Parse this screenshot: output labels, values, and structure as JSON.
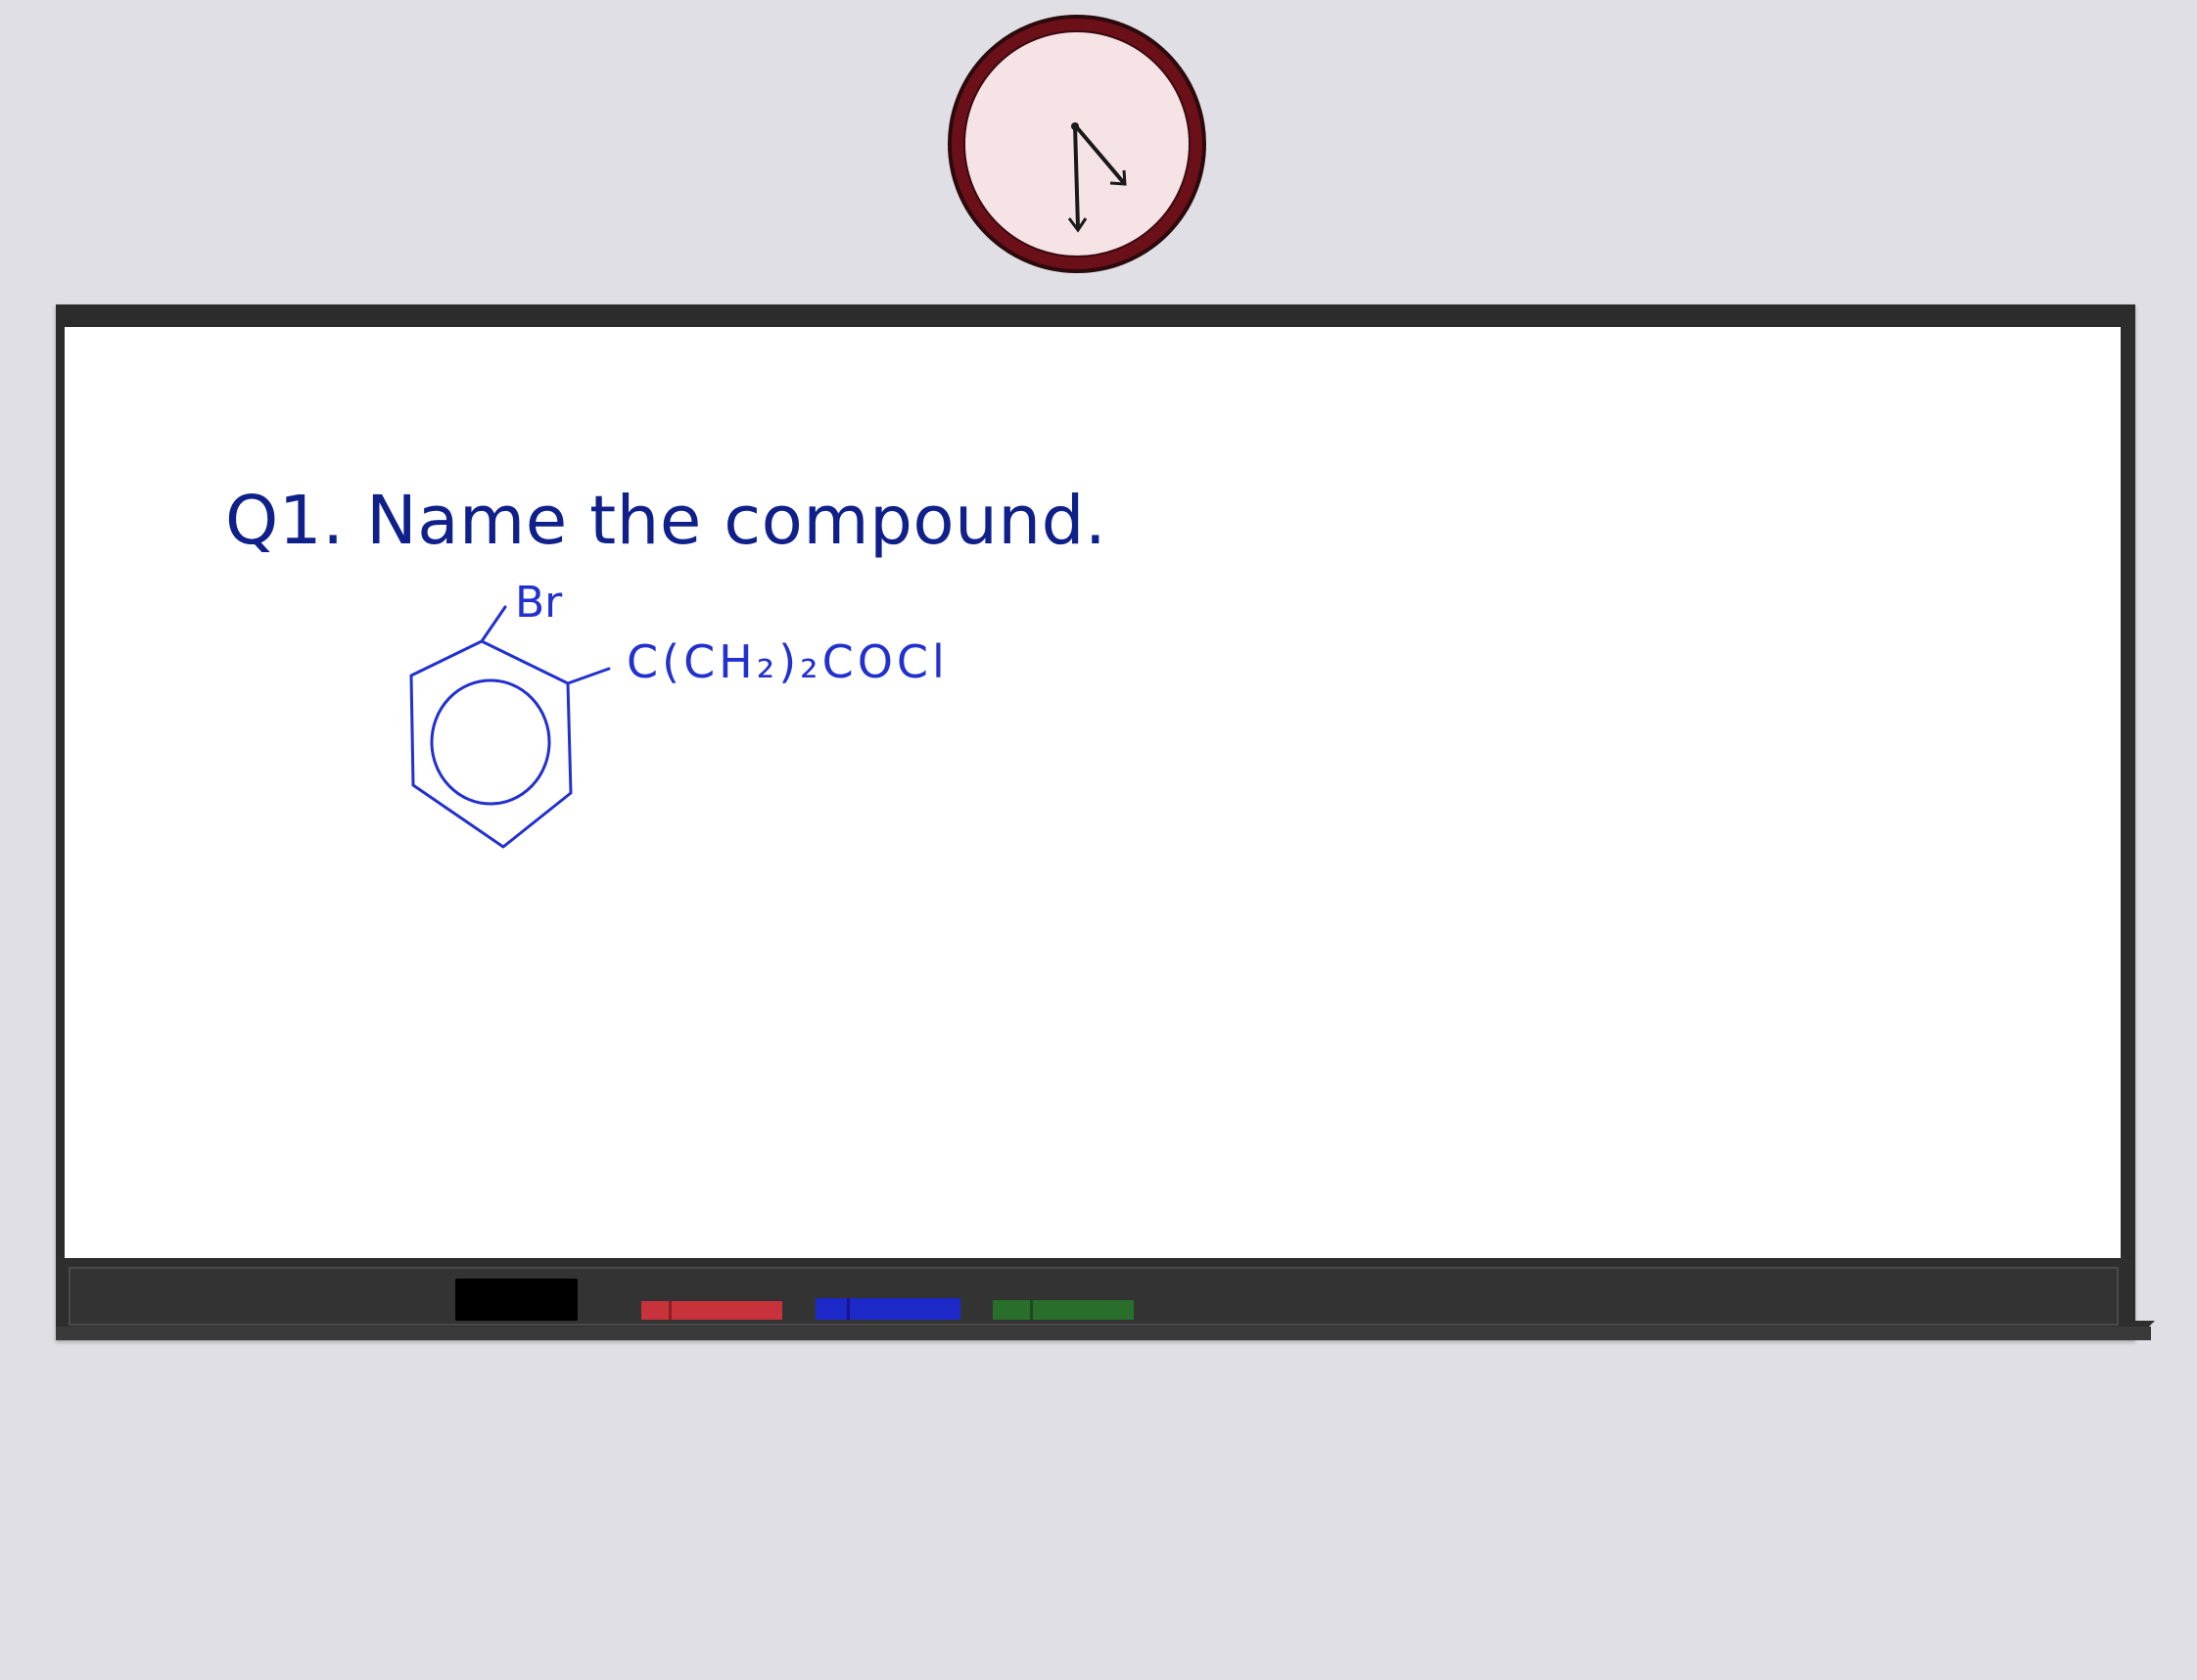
{
  "question": {
    "text": "Q1. Name the compound."
  },
  "structure": {
    "substituent_top": "Br",
    "substituent_side": "C(CH₂)₂COCl"
  },
  "colors": {
    "ink": "#2230d0",
    "title_ink": "#10208a",
    "background": "#e0dfe5",
    "board_frame": "#2c2c2c",
    "clock_rim": "#6b0f18",
    "clock_face": "#f6e3e5",
    "eraser": "#000000",
    "marker_red": "#c8323a",
    "marker_blue": "#1c28c8",
    "marker_green": "#2a6e2c"
  },
  "icons": {
    "clock": "wall-clock-icon",
    "eraser": "eraser-icon",
    "markers": [
      "red-marker-icon",
      "blue-marker-icon",
      "green-marker-icon"
    ]
  }
}
